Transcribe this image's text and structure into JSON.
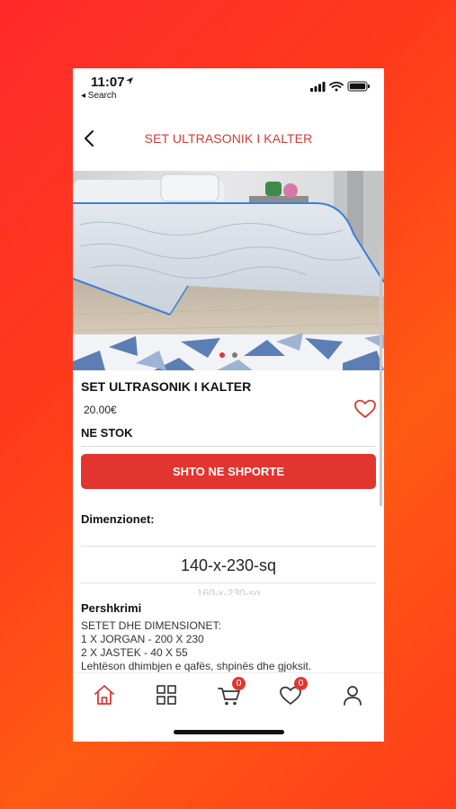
{
  "status_bar": {
    "time": "11:07",
    "back_app": "◂ Search"
  },
  "nav": {
    "title": "SET ULTRASONIK I KALTER"
  },
  "colors": {
    "accent": "#e3352f",
    "title_red": "#d63a33"
  },
  "product": {
    "name": "SET ULTRASONIK I KALTER",
    "price": "20.00€",
    "stock": "NE STOK",
    "add_to_cart": "SHTO NE SHPORTE"
  },
  "dimensions": {
    "label": "Dimenzionet:",
    "selected": "140-x-230-sq",
    "next_option": "160-x-230-sq"
  },
  "description": {
    "title": "Pershkrimi",
    "lines": [
      "SETET DHE DIMENSIONET:",
      "1 X JORGAN - 200 X 230",
      "2 X JASTEK - 40 X 55",
      "Lehtëson dhimbjen e qafës, shpinës dhe gjoksit."
    ]
  },
  "tabbar": {
    "cart_count": "0",
    "wishlist_count": "0"
  }
}
